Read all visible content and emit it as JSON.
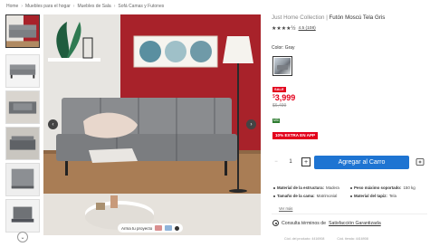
{
  "breadcrumb": [
    "Home",
    "Muebles para el hogar",
    "Muebles de Sala",
    "Sofá Camas y Futones"
  ],
  "gallery": {
    "arma_label": "Arma tu proyecto",
    "prev_symbol": "‹",
    "next_symbol": "›",
    "more_symbol": "⌄"
  },
  "product": {
    "brand": "Just Home Collection",
    "title": "Futón Moscú Tela Gris",
    "stars": "★★★★½",
    "rating_text": "4.5 (108)",
    "color_label": "Color: Gray",
    "sale_badge": "SALE",
    "currency": "$",
    "price": "3,999",
    "old_price": "$6,499",
    "msi_badge": "MSI",
    "extra_badge": "10% EXTRA EN APP",
    "quantity": "1",
    "minus_symbol": "−",
    "plus_symbol": "+",
    "add_to_cart": "Agregar al Carro"
  },
  "specs": [
    {
      "key": "Material de la estructura:",
      "value": "Madera"
    },
    {
      "key": "Peso máximo soportado:",
      "value": "150 kg"
    },
    {
      "key": "Tamaño de la cama:",
      "value": "Matrimonial"
    },
    {
      "key": "Material del tapiz:",
      "value": "Tela"
    }
  ],
  "ver_mas": "Ver más",
  "consult": {
    "prefix": "Consulta términos de",
    "link": "Satisfacción Garantizada"
  },
  "ids": {
    "online": "Cód. del producto: 4416908",
    "store": "Cód. tienda: 4416908"
  },
  "colors": {
    "accent_blue": "#1e74d2",
    "sale_red": "#e3001b",
    "wall_red": "#a8222a",
    "sofa_gray": "#8a8c8f",
    "msi_green": "#2f7d32"
  }
}
